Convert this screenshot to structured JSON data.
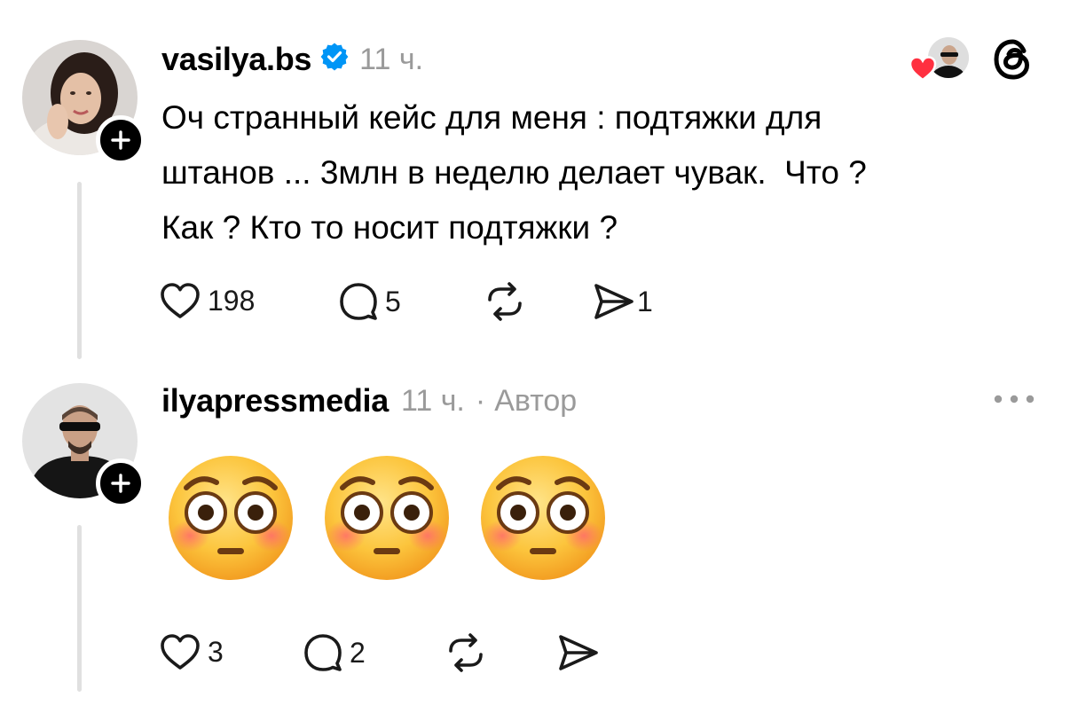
{
  "posts": [
    {
      "username": "vasilya.bs",
      "verified": true,
      "time": "11 ч.",
      "text": "Оч странный кейс для меня : подтяжки для\nштанов ... 3млн в неделю делает чувак.  Что ?\nКак ? Кто то носит подтяжки ?",
      "likes": "198",
      "replies": "5",
      "shares": "1"
    },
    {
      "username": "ilyapressmedia",
      "time": "11 ч.",
      "separator": "·",
      "author_tag": "Автор",
      "emoji_content": [
        "flushed-face",
        "flushed-face",
        "flushed-face"
      ],
      "likes": "3",
      "replies": "2"
    }
  ],
  "icons": {
    "verified_badge": "verified-badge-icon",
    "threads_logo": "threads-logo-icon",
    "like": "heart-icon",
    "reply": "comment-icon",
    "repost": "repost-icon",
    "share": "send-icon",
    "more": "more-horizontal-icon",
    "follow": "plus-icon"
  },
  "colors": {
    "verified_blue": "#0095f6",
    "like_red": "#ff3040",
    "meta_gray": "#9a9a9a",
    "thread_line": "#e0e0e0"
  }
}
